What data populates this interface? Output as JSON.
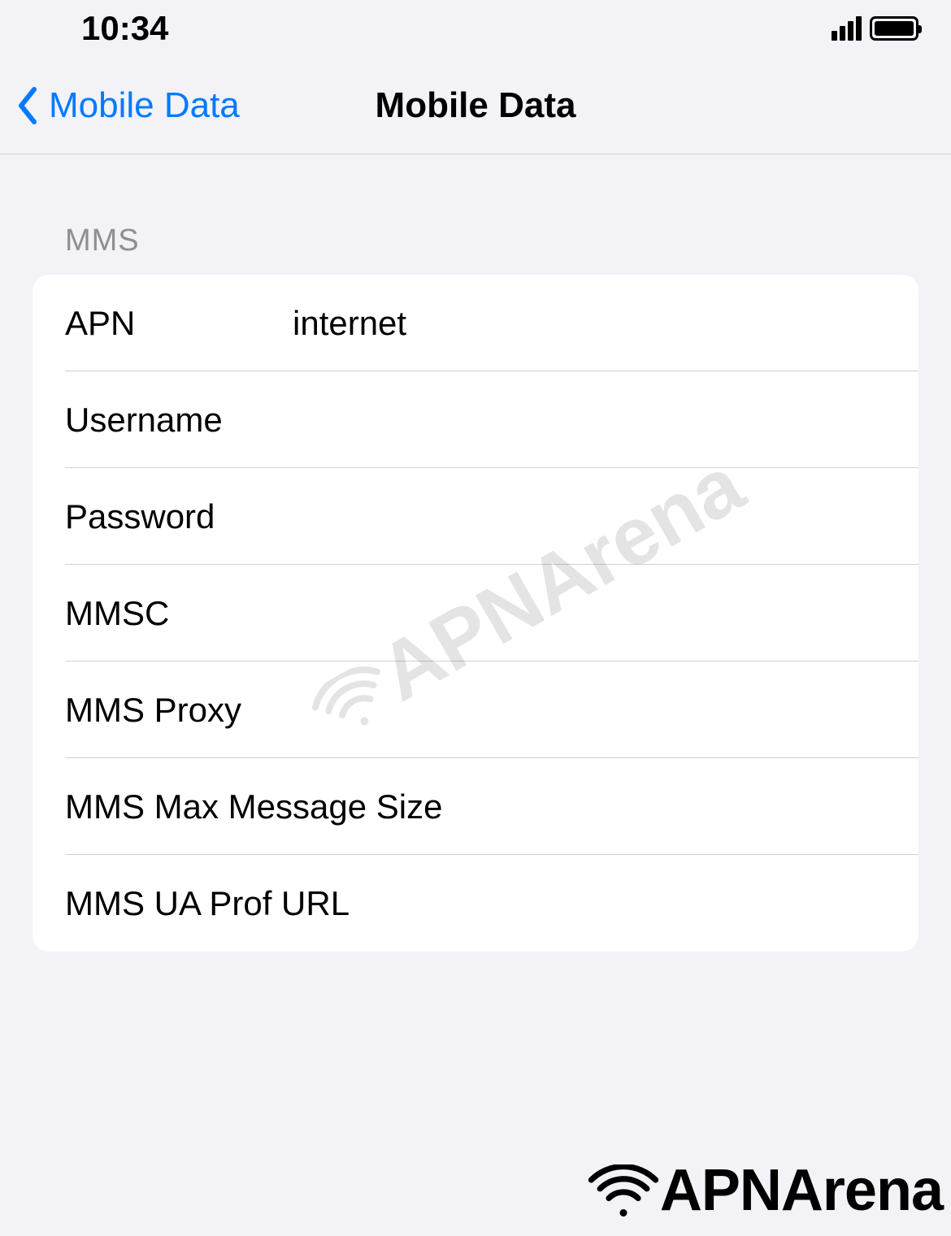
{
  "status": {
    "time": "10:34"
  },
  "nav": {
    "back_label": "Mobile Data",
    "title": "Mobile Data"
  },
  "section": {
    "header": "MMS"
  },
  "fields": {
    "apn_label": "APN",
    "apn_value": "internet",
    "username_label": "Username",
    "username_value": "",
    "password_label": "Password",
    "password_value": "",
    "mmsc_label": "MMSC",
    "mmsc_value": "",
    "mms_proxy_label": "MMS Proxy",
    "mms_proxy_value": "",
    "mms_max_label": "MMS Max Message Size",
    "mms_max_value": "",
    "mms_ua_label": "MMS UA Prof URL",
    "mms_ua_value": ""
  },
  "watermark": {
    "text": "APNArena"
  }
}
